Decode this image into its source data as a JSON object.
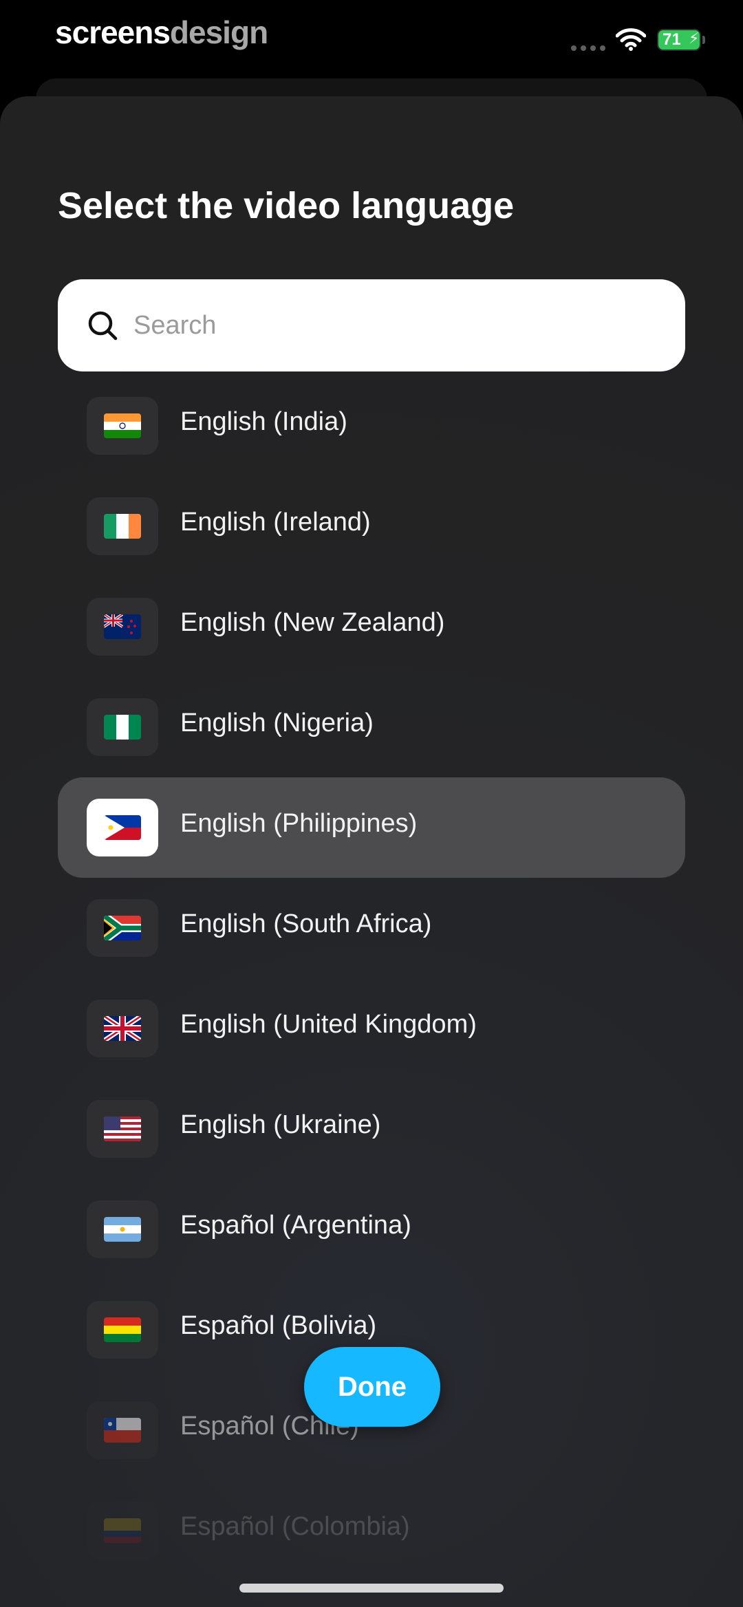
{
  "status_bar": {
    "brand_part1": "screens",
    "brand_part2": "design",
    "battery": "71",
    "icons": [
      "signal-dots-icon",
      "wifi-icon",
      "battery-icon"
    ]
  },
  "sheet": {
    "title": "Select the video language",
    "search": {
      "placeholder": "Search",
      "value": "",
      "icon": "search-icon"
    },
    "languages": [
      {
        "label": "English (India)",
        "flag": "india-flag-icon",
        "selected": false
      },
      {
        "label": "English (Ireland)",
        "flag": "ireland-flag-icon",
        "selected": false
      },
      {
        "label": "English (New Zealand)",
        "flag": "new-zealand-flag-icon",
        "selected": false
      },
      {
        "label": "English (Nigeria)",
        "flag": "nigeria-flag-icon",
        "selected": false
      },
      {
        "label": "English (Philippines)",
        "flag": "philippines-flag-icon",
        "selected": true
      },
      {
        "label": "English (South Africa)",
        "flag": "south-africa-flag-icon",
        "selected": false
      },
      {
        "label": "English (United Kingdom)",
        "flag": "united-kingdom-flag-icon",
        "selected": false
      },
      {
        "label": "English (Ukraine)",
        "flag": "united-states-flag-icon",
        "selected": false
      },
      {
        "label": "Español (Argentina)",
        "flag": "argentina-flag-icon",
        "selected": false
      },
      {
        "label": "Español (Bolivia)",
        "flag": "bolivia-flag-icon",
        "selected": false
      },
      {
        "label": "Español (Chile)",
        "flag": "chile-flag-icon",
        "selected": false
      },
      {
        "label": "Español (Colombia)",
        "flag": "colombia-flag-icon",
        "selected": false
      }
    ],
    "done_label": "Done"
  },
  "colors": {
    "accent": "#16b9ff",
    "selected_row": "#4c4c4e",
    "battery": "#34c759"
  }
}
